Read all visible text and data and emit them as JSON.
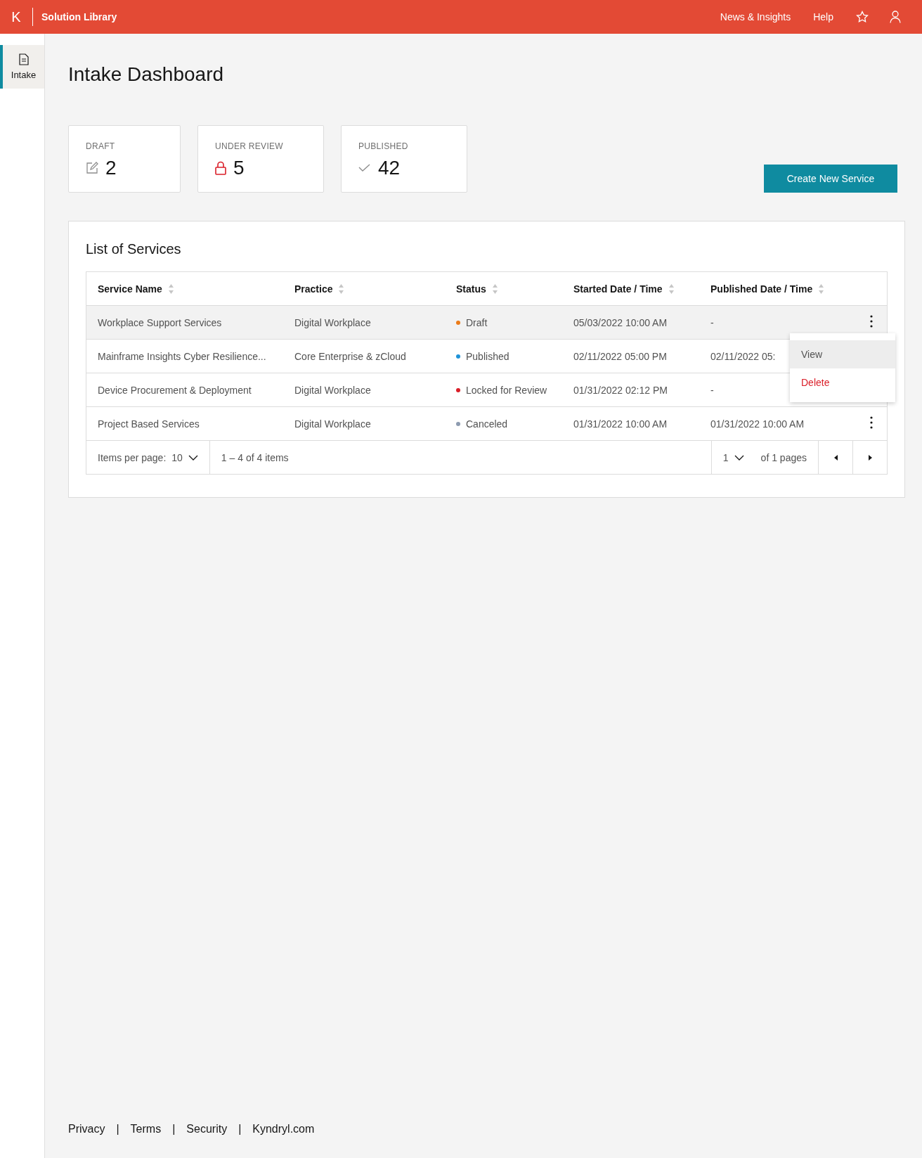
{
  "header": {
    "logo": "K",
    "title": "Solution Library",
    "links": [
      "News & Insights",
      "Help"
    ]
  },
  "sidebar": {
    "items": [
      {
        "label": "Intake",
        "selected": true
      }
    ]
  },
  "page": {
    "title": "Intake Dashboard"
  },
  "stats": [
    {
      "kind": "draft",
      "label": "DRAFT",
      "value": "2"
    },
    {
      "kind": "review",
      "label": "UNDER REVIEW",
      "value": "5"
    },
    {
      "kind": "published",
      "label": "PUBLISHED",
      "value": "42"
    }
  ],
  "create_button": "Create New Service",
  "table": {
    "title": "List of Services",
    "columns": [
      "Service Name",
      "Practice",
      "Status",
      "Started Date / Time",
      "Published Date / Time"
    ],
    "rows": [
      {
        "name": "Workplace Support Services",
        "practice": "Digital Workplace",
        "status": "Draft",
        "color": "#eb7b18",
        "started": "05/03/2022 10:00 AM",
        "published": "-",
        "highlighted": true
      },
      {
        "name": "Mainframe Insights Cyber Resilience...",
        "practice": "Core Enterprise & zCloud",
        "status": "Published",
        "color": "#1f93d8",
        "started": "02/11/2022 05:00 PM",
        "published": "02/11/2022 05:",
        "highlighted": false
      },
      {
        "name": "Device Procurement & Deployment",
        "practice": "Digital Workplace",
        "status": "Locked for Review",
        "color": "#da1e28",
        "started": "01/31/2022 02:12 PM",
        "published": "-",
        "highlighted": false
      },
      {
        "name": "Project Based Services",
        "practice": "Digital Workplace",
        "status": "Canceled",
        "color": "#8d9bb0",
        "started": "01/31/2022 10:00 AM",
        "published": "01/31/2022 10:00 AM",
        "highlighted": false
      }
    ],
    "menu": {
      "items": [
        {
          "label": "View",
          "kind": "normal",
          "selected": true
        },
        {
          "label": "Delete",
          "kind": "danger",
          "selected": false
        }
      ]
    },
    "pagination": {
      "items_label": "Items per page:",
      "per_page": "10",
      "range": "1 – 4 of 4 items",
      "page": "1",
      "pages": "of 1 pages"
    }
  },
  "footer": {
    "items": [
      {
        "kind": "link",
        "text": "Privacy"
      },
      {
        "kind": "separator",
        "text": "|"
      },
      {
        "kind": "link",
        "text": "Terms"
      },
      {
        "kind": "separator",
        "text": "|"
      },
      {
        "kind": "link",
        "text": "Security"
      },
      {
        "kind": "separator",
        "text": "|"
      },
      {
        "kind": "link",
        "text": "Kyndryl.com"
      }
    ]
  }
}
